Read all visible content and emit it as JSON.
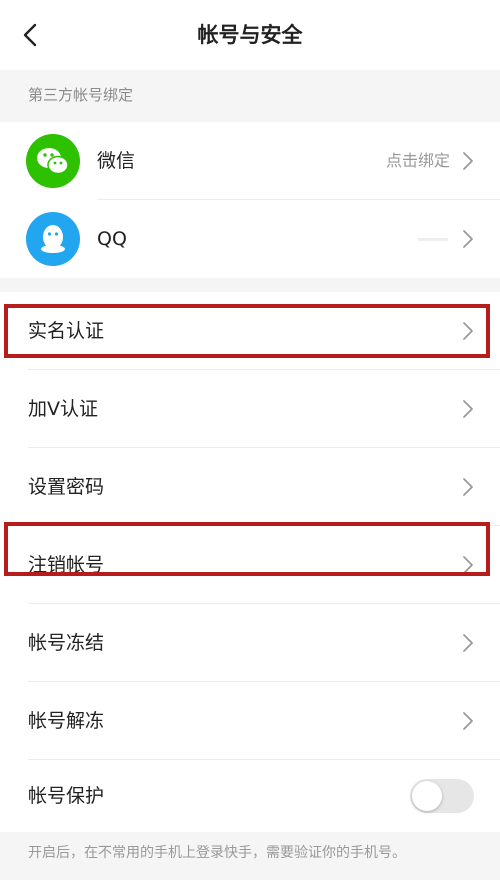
{
  "header": {
    "title": "帐号与安全",
    "back_icon": "chevron-left-icon"
  },
  "third_party": {
    "section_label": "第三方帐号绑定",
    "wechat": {
      "label": "微信",
      "action": "点击绑定",
      "icon": "wechat-icon",
      "color": "#2dc100"
    },
    "qq": {
      "label": "QQ",
      "icon": "qq-icon",
      "color": "#23a6f0"
    }
  },
  "settings": {
    "real_name": "实名认证",
    "v_verify": "加V认证",
    "set_password": "设置密码",
    "cancel_account": "注销帐号",
    "freeze_account": "帐号冻结",
    "unfreeze_account": "帐号解冻",
    "account_protect": {
      "label": "帐号保护",
      "enabled": false
    }
  },
  "footer": {
    "note": "开启后，在不常用的手机上登录快手，需要验证你的手机号。"
  },
  "highlight_color": "#b71c1c"
}
